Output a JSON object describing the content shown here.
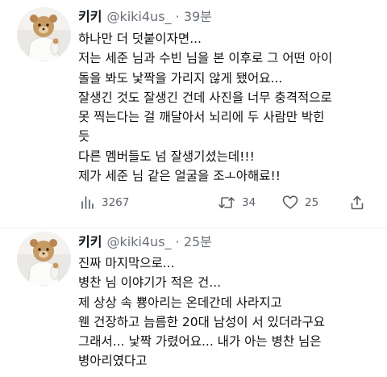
{
  "tweets": [
    {
      "author": {
        "name": "키키",
        "handle": "@kiki4us_",
        "dot": "·",
        "time": "39분"
      },
      "lines": [
        "하나만 더 덧붙이자면...",
        "저는 세준 님과 수빈 님을 본 이후로 그 어떤 아이",
        "돌을 봐도 낯짝을 가리지 않게 됐어요...",
        "잘생긴 것도 잘생긴 건데 사진을 너무 충격적으로",
        "못 찍는다는 걸 깨달아서 뇌리에 두 사람만 박힌",
        "듯",
        "다른 멤버들도 넘 잘생기셨는데!!!",
        "제가 세준 님 같은 얼굴을 조ㅗ아해료!!"
      ],
      "stats": {
        "views": "3267",
        "retweets": "34",
        "likes": "25"
      },
      "icons": {
        "views": "bar-chart-icon",
        "retweet": "retweet-icon",
        "like": "heart-icon",
        "share": "share-icon"
      }
    },
    {
      "author": {
        "name": "키키",
        "handle": "@kiki4us_",
        "dot": "·",
        "time": "25분"
      },
      "lines": [
        "진짜 마지막으로...",
        "병찬 님 이야기가 적은 건...",
        "제 상상 속 뿅아리는 온데간데 사라지고",
        "웬 건장하고 늠름한 20대 남성이 서 있더라구요",
        "그래서... 낯짝 가렸어요... 내가 아는 병찬 님은",
        "병아리였다고"
      ]
    }
  ],
  "colors": {
    "text": "#0f1419",
    "secondary": "#6b7077",
    "icon": "#5c6168",
    "background": "#ffffff"
  }
}
